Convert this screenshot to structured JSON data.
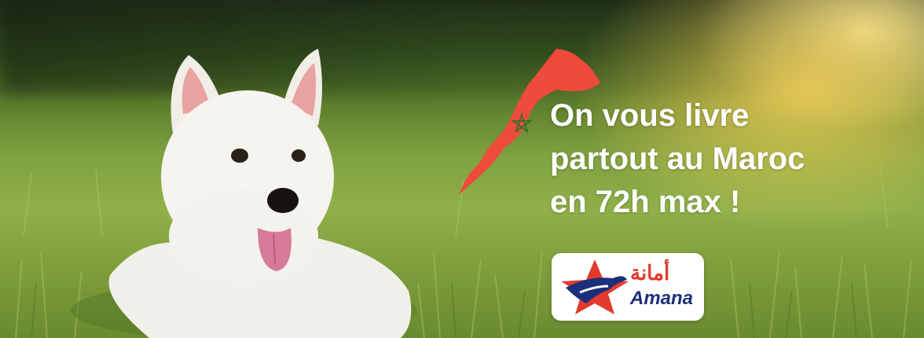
{
  "banner": {
    "headline_lines": [
      "On vous livre",
      "partout au Maroc",
      "en 72h max !"
    ]
  },
  "logo": {
    "arabic_text": "أمانة",
    "latin_text": "Amana",
    "icon": "amana-star-horse-icon"
  },
  "map": {
    "icon": "morocco-map-icon",
    "emblem": "pentagram-star-icon"
  },
  "colors": {
    "map_red": "#ef4b3a",
    "headline": "#ffffff",
    "logo_red": "#e23b2e",
    "logo_blue": "#1c2f7a"
  },
  "photo": {
    "subject": "dog-photo"
  }
}
